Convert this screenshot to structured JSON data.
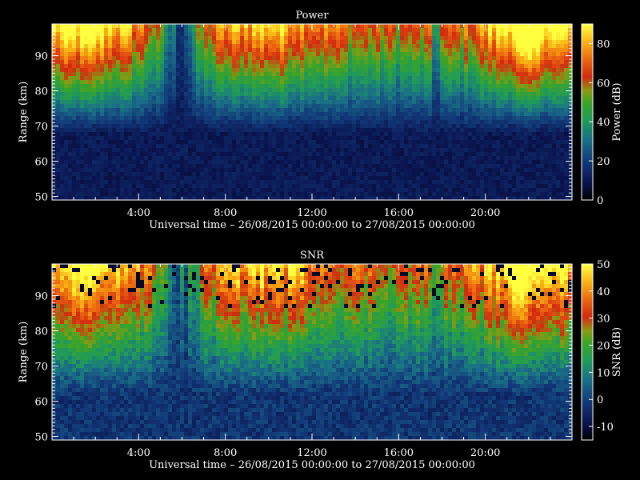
{
  "chart_data": [
    {
      "type": "heatmap",
      "title": "Power",
      "xlabel": "Universal time – 26/08/2015 00:00:00 to 27/08/2015 00:00:00",
      "ylabel": "Range (km)",
      "x_ticks": [
        "4:00",
        "8:00",
        "12:00",
        "16:00",
        "20:00"
      ],
      "x_tick_values": [
        4,
        8,
        12,
        16,
        20
      ],
      "xlim": [
        0,
        24
      ],
      "y_ticks": [
        50,
        60,
        70,
        80,
        90
      ],
      "ylim": [
        49,
        99
      ],
      "colorbar": {
        "label": "Power (dB)",
        "ticks": [
          0,
          20,
          40,
          60,
          80
        ],
        "range": [
          0,
          90
        ]
      }
    },
    {
      "type": "heatmap",
      "title": "SNR",
      "xlabel": "Universal time – 26/08/2015 00:00:00 to 27/08/2015 00:00:00",
      "ylabel": "Range (km)",
      "x_ticks": [
        "4:00",
        "8:00",
        "12:00",
        "16:00",
        "20:00"
      ],
      "x_tick_values": [
        4,
        8,
        12,
        16,
        20
      ],
      "xlim": [
        0,
        24
      ],
      "y_ticks": [
        50,
        60,
        70,
        80,
        90
      ],
      "ylim": [
        49,
        99
      ],
      "colorbar": {
        "label": "SNR (dB)",
        "ticks": [
          -10,
          0,
          10,
          20,
          30,
          40,
          50
        ],
        "range": [
          -15,
          50
        ]
      }
    }
  ]
}
